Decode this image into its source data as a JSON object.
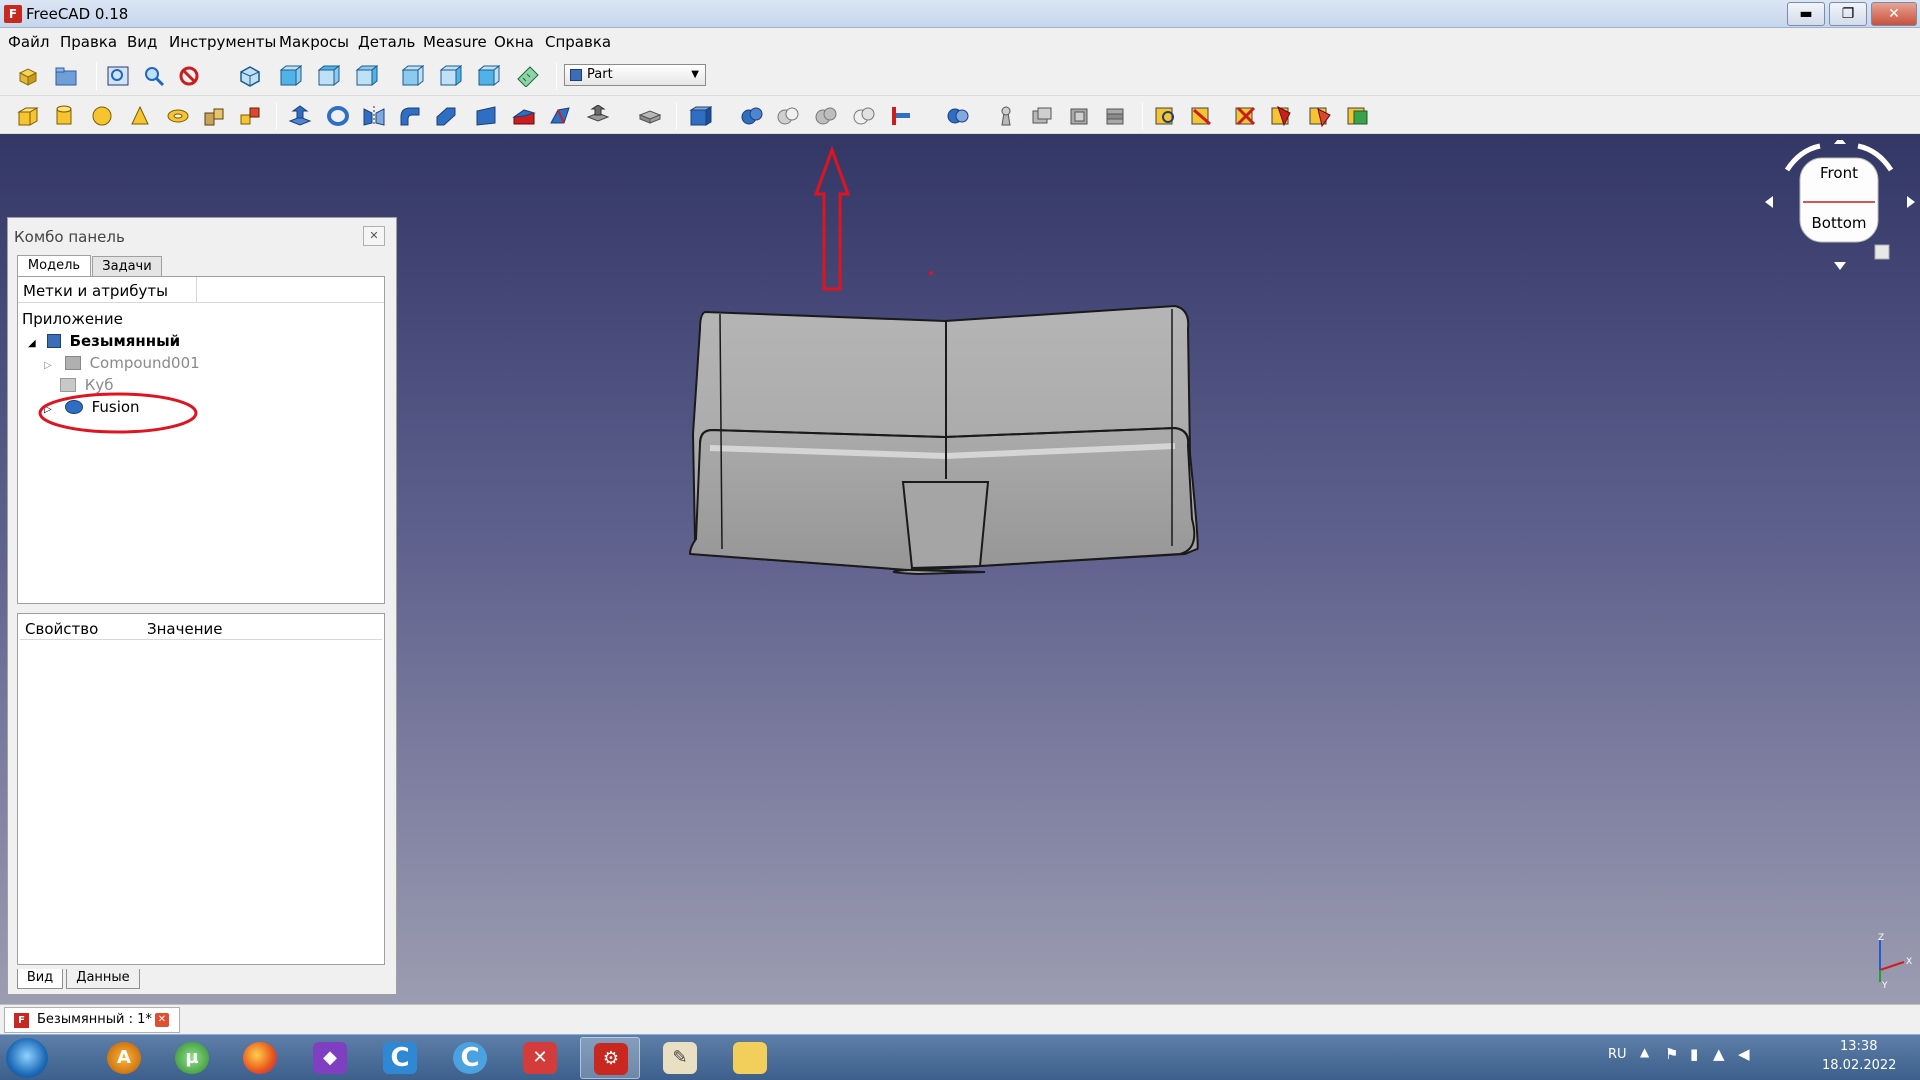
{
  "window": {
    "title": "FreeCAD 0.18",
    "app_icon_letter": "F",
    "min_glyph": "▬",
    "max_glyph": "❐",
    "close_glyph": "✕"
  },
  "menu": [
    "Файл",
    "Правка",
    "Вид",
    "Инструменты",
    "Макросы",
    "Деталь",
    "Measure",
    "Окна",
    "Справка"
  ],
  "workbench": {
    "selected": "Part"
  },
  "combo": {
    "title": "Комбо панель",
    "close_glyph": "✕",
    "tabs": [
      "Модель",
      "Задачи"
    ],
    "tree_header": "Метки и атрибуты",
    "tree": {
      "root_label": "Приложение",
      "document": "Безымянный",
      "items": [
        {
          "label": "Compound001",
          "state": "hidden"
        },
        {
          "label": "Куб",
          "state": "hidden"
        },
        {
          "label": "Fusion",
          "state": "visible"
        }
      ]
    },
    "props_headers": [
      "Свойство",
      "Значение"
    ],
    "bottom_tabs": [
      "Вид",
      "Данные"
    ]
  },
  "navcube": {
    "faces": [
      "Front",
      "Bottom"
    ]
  },
  "axis": {
    "labels": [
      "Z",
      "X",
      "Y"
    ]
  },
  "document_tab": {
    "label": "Безымянный : 1*",
    "close_glyph": "✕"
  },
  "taskbar": {
    "apps": [
      "aimp",
      "utorrent",
      "firefox",
      "visual-studio",
      "ccleaner",
      "recuva",
      "pdf-reader",
      "freecad",
      "paint",
      "explorer"
    ],
    "tray": {
      "lang": "RU",
      "time": "13:38",
      "date": "18.02.2022"
    }
  },
  "colors": {
    "annotation_red": "#e0141e",
    "shape_gray": "#a6a6a6",
    "viewport_top": "#333766",
    "viewport_bottom": "#9c9cb2"
  }
}
